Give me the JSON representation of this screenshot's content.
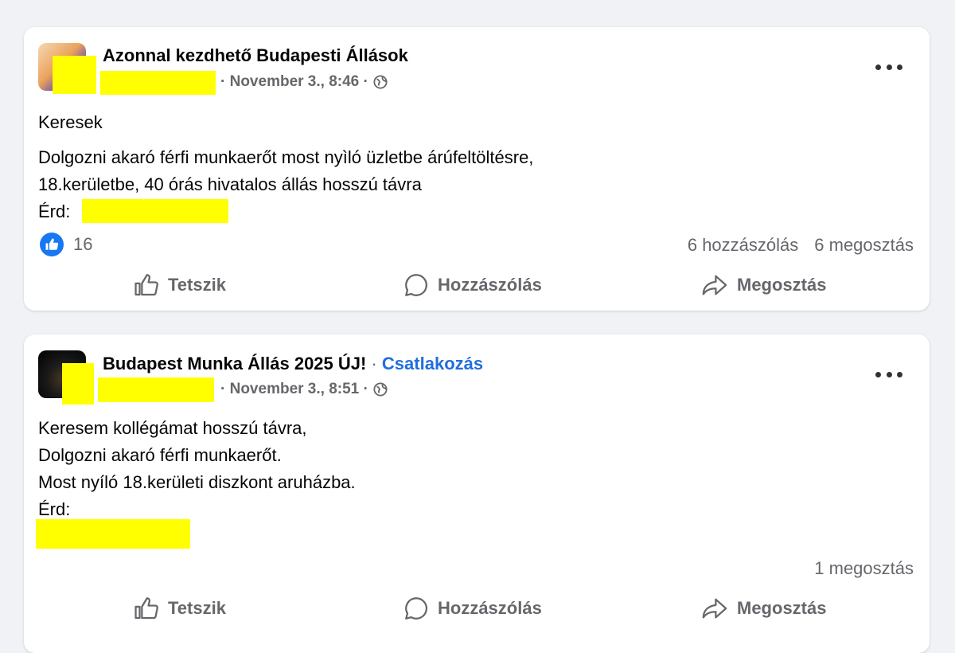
{
  "posts": [
    {
      "group_name": "Azonnal kezdhető Budapesti Állások",
      "date": "November 3., 8:46",
      "separator": "·",
      "body": [
        "Keresek",
        "Dolgozni akaró férfi munkaerőt most nyìló üzletbe árúfeltöltésre,",
        "18.kerületbe, 40 órás hivatalos állás hosszú távra",
        " Érd:"
      ],
      "reaction_count": "16",
      "comments": "6 hozzászólás",
      "shares": "6 megosztás",
      "actions": {
        "like": "Tetszik",
        "comment": "Hozzászólás",
        "share": "Megosztás"
      }
    },
    {
      "group_name": "Budapest Munka Állás 2025 ÚJ!",
      "join_label": "Csatlakozás",
      "date": "November 3., 8:51",
      "separator": "·",
      "body": [
        "Keresem kollégámat hosszú távra,",
        "Dolgozni akaró férfi munkaerőt.",
        "Most nyíló 18.kerületi diszkont aruházba.",
        "Érd:"
      ],
      "shares": "1 megosztás",
      "actions": {
        "like": "Tetszik",
        "comment": "Hozzászólás",
        "share": "Megosztás"
      }
    }
  ],
  "colors": {
    "background": "#f0f2f5",
    "card": "#ffffff",
    "redaction": "#ffff00",
    "link": "#216fdb",
    "like_blue": "#1877f2",
    "muted_text": "#65676b"
  },
  "icons": [
    "globe-icon",
    "more-options-icon",
    "like-reaction-icon",
    "thumbs-up-icon",
    "comment-bubble-icon",
    "share-arrow-icon"
  ]
}
